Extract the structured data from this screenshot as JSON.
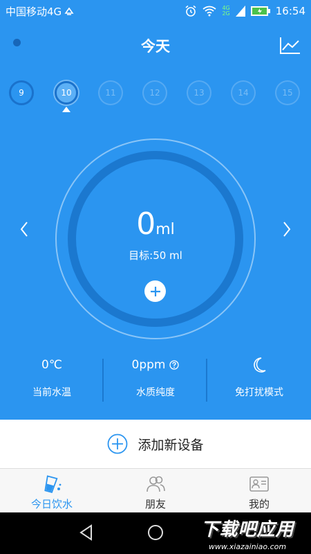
{
  "status_bar": {
    "carrier": "中国移动4G",
    "net_tags": [
      "4G",
      "2G"
    ],
    "time": "16:54"
  },
  "header": {
    "title": "今天"
  },
  "days": [
    {
      "label": "9",
      "state": "past"
    },
    {
      "label": "10",
      "state": "active"
    },
    {
      "label": "11",
      "state": "future"
    },
    {
      "label": "12",
      "state": "future"
    },
    {
      "label": "13",
      "state": "future"
    },
    {
      "label": "14",
      "state": "future"
    },
    {
      "label": "15",
      "state": "future"
    }
  ],
  "intake": {
    "value": "0",
    "unit": "ml",
    "target": "目标:50 ml"
  },
  "stats": {
    "temperature": {
      "value": "0℃",
      "label": "当前水温"
    },
    "purity": {
      "value": "0ppm",
      "label": "水质纯度"
    },
    "dnd": {
      "label": "免打扰模式"
    }
  },
  "add_device": {
    "label": "添加新设备"
  },
  "tabs": [
    {
      "label": "今日饮水",
      "icon": "water-glass-icon",
      "active": true
    },
    {
      "label": "朋友",
      "icon": "friends-icon",
      "active": false
    },
    {
      "label": "我的",
      "icon": "profile-card-icon",
      "active": false
    }
  ],
  "watermark": {
    "title": "下载吧应用",
    "url": "www.xiazainiao.com"
  },
  "colors": {
    "primary": "#2b95f0",
    "ring": "#1b78cf",
    "tab_active": "#2b95f0"
  }
}
